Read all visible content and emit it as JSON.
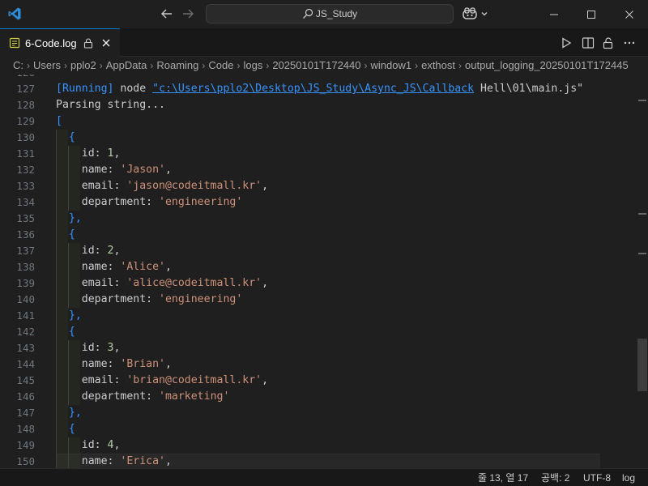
{
  "titlebar": {
    "search_text": "JS_Study",
    "logo_icon": "vscode-logo-icon",
    "accent_color": "#0078d4"
  },
  "tab": {
    "label": "6-Code.log",
    "icon": "log-file-icon"
  },
  "breadcrumbs": [
    "C:",
    "Users",
    "pplo2",
    "AppData",
    "Roaming",
    "Code",
    "logs",
    "20250101T172440",
    "window1",
    "exthost",
    "output_logging_20250101T172445"
  ],
  "editor": {
    "lines": [
      {
        "num": "126",
        "tokens": [
          {
            "t": "",
            "c": ""
          }
        ]
      },
      {
        "num": "127",
        "tokens": [
          {
            "t": "[Running]",
            "c": "t-running"
          },
          {
            "t": " node ",
            "c": ""
          },
          {
            "t": "\"",
            "c": "t-path-q"
          },
          {
            "t": "c:\\Users\\pplo2\\Desktop\\JS_Study\\Async_JS\\Callback",
            "c": "t-path"
          },
          {
            "t": " Hell\\01\\main.js\"",
            "c": ""
          }
        ]
      },
      {
        "num": "128",
        "tokens": [
          {
            "t": "Parsing string...",
            "c": ""
          }
        ]
      },
      {
        "num": "129",
        "tokens": [
          {
            "t": "[",
            "c": "t-bracket"
          }
        ]
      },
      {
        "num": "130",
        "tokens": [
          {
            "t": "  {",
            "c": "t-bracket"
          }
        ]
      },
      {
        "num": "131",
        "tokens": [
          {
            "t": "    id: ",
            "c": ""
          },
          {
            "t": "1",
            "c": "t-num"
          },
          {
            "t": ",",
            "c": ""
          }
        ]
      },
      {
        "num": "132",
        "tokens": [
          {
            "t": "    name: ",
            "c": ""
          },
          {
            "t": "'Jason'",
            "c": "t-str"
          },
          {
            "t": ",",
            "c": ""
          }
        ]
      },
      {
        "num": "133",
        "tokens": [
          {
            "t": "    email: ",
            "c": ""
          },
          {
            "t": "'jason@codeitmall.kr'",
            "c": "t-str"
          },
          {
            "t": ",",
            "c": ""
          }
        ]
      },
      {
        "num": "134",
        "tokens": [
          {
            "t": "    department: ",
            "c": ""
          },
          {
            "t": "'engineering'",
            "c": "t-str"
          }
        ]
      },
      {
        "num": "135",
        "tokens": [
          {
            "t": "  },",
            "c": "t-bracket"
          }
        ]
      },
      {
        "num": "136",
        "tokens": [
          {
            "t": "  {",
            "c": "t-bracket"
          }
        ]
      },
      {
        "num": "137",
        "tokens": [
          {
            "t": "    id: ",
            "c": ""
          },
          {
            "t": "2",
            "c": "t-num"
          },
          {
            "t": ",",
            "c": ""
          }
        ]
      },
      {
        "num": "138",
        "tokens": [
          {
            "t": "    name: ",
            "c": ""
          },
          {
            "t": "'Alice'",
            "c": "t-str"
          },
          {
            "t": ",",
            "c": ""
          }
        ]
      },
      {
        "num": "139",
        "tokens": [
          {
            "t": "    email: ",
            "c": ""
          },
          {
            "t": "'alice@codeitmall.kr'",
            "c": "t-str"
          },
          {
            "t": ",",
            "c": ""
          }
        ]
      },
      {
        "num": "140",
        "tokens": [
          {
            "t": "    department: ",
            "c": ""
          },
          {
            "t": "'engineering'",
            "c": "t-str"
          }
        ]
      },
      {
        "num": "141",
        "tokens": [
          {
            "t": "  },",
            "c": "t-bracket"
          }
        ]
      },
      {
        "num": "142",
        "tokens": [
          {
            "t": "  {",
            "c": "t-bracket"
          }
        ]
      },
      {
        "num": "143",
        "tokens": [
          {
            "t": "    id: ",
            "c": ""
          },
          {
            "t": "3",
            "c": "t-num"
          },
          {
            "t": ",",
            "c": ""
          }
        ]
      },
      {
        "num": "144",
        "tokens": [
          {
            "t": "    name: ",
            "c": ""
          },
          {
            "t": "'Brian'",
            "c": "t-str"
          },
          {
            "t": ",",
            "c": ""
          }
        ]
      },
      {
        "num": "145",
        "tokens": [
          {
            "t": "    email: ",
            "c": ""
          },
          {
            "t": "'brian@codeitmall.kr'",
            "c": "t-str"
          },
          {
            "t": ",",
            "c": ""
          }
        ]
      },
      {
        "num": "146",
        "tokens": [
          {
            "t": "    department: ",
            "c": ""
          },
          {
            "t": "'marketing'",
            "c": "t-str"
          }
        ]
      },
      {
        "num": "147",
        "tokens": [
          {
            "t": "  },",
            "c": "t-bracket"
          }
        ]
      },
      {
        "num": "148",
        "tokens": [
          {
            "t": "  {",
            "c": "t-bracket"
          }
        ]
      },
      {
        "num": "149",
        "tokens": [
          {
            "t": "    id: ",
            "c": ""
          },
          {
            "t": "4",
            "c": "t-num"
          },
          {
            "t": ",",
            "c": ""
          }
        ]
      },
      {
        "num": "150",
        "tokens": [
          {
            "t": "    name: ",
            "c": ""
          },
          {
            "t": "'Erica'",
            "c": "t-str"
          },
          {
            "t": ",",
            "c": ""
          }
        ]
      }
    ],
    "current_line": "150",
    "colors": {
      "keyword_blue": "#3794ff",
      "string": "#ce9178",
      "number": "#b5cea8",
      "property": "#9cdcfe"
    }
  },
  "statusbar": {
    "position": "줄 13, 열 17",
    "spaces": "공백: 2",
    "encoding": "UTF-8",
    "language": "log"
  }
}
